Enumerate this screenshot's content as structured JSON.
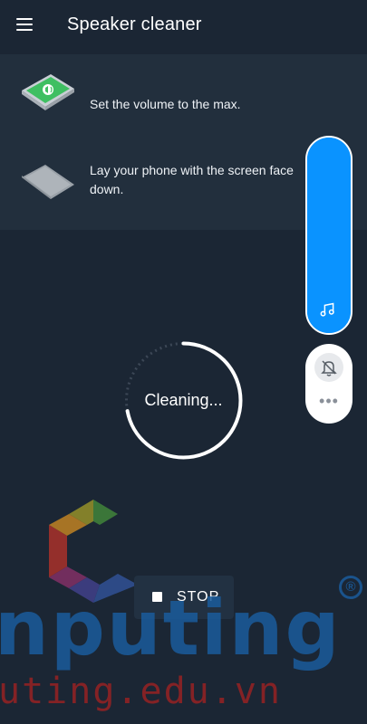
{
  "app": {
    "title": "Speaker cleaner",
    "menu_icon": "hamburger-menu-icon"
  },
  "instructions": [
    {
      "icon": "phone-speaker-icon",
      "text": "Set the volume to the max."
    },
    {
      "icon": "phone-facedown-icon",
      "text": "Lay your phone with the screen face down."
    }
  ],
  "volume": {
    "level": 1.0,
    "icon": "music-note-icon"
  },
  "mini_panel": {
    "bell_icon": "bell-off-icon",
    "more_icon": "more-dots-icon",
    "more_glyph": "•••"
  },
  "progress": {
    "label": "Cleaning...",
    "fraction": 0.72
  },
  "stop_button": {
    "label": "STOP",
    "icon": "stop-icon"
  },
  "watermark": {
    "text": "nputing",
    "reg": "®",
    "url": "uting.edu.vn"
  },
  "colors": {
    "background": "#1b2634",
    "accent": "#0a93ff",
    "card": "#222f3d"
  }
}
